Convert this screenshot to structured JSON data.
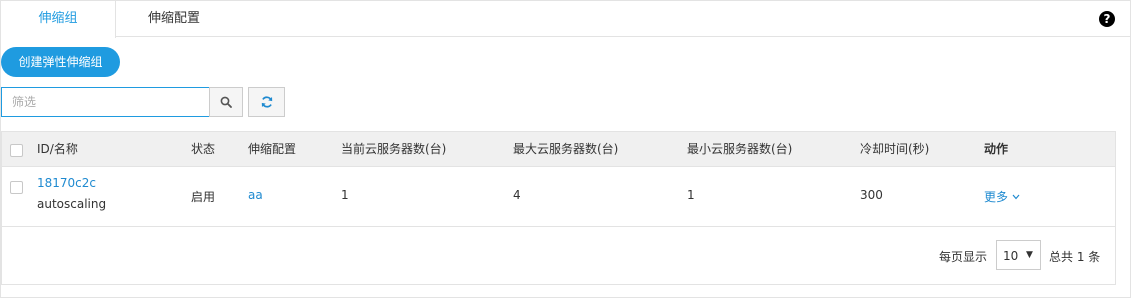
{
  "tabs": [
    {
      "label": "伸缩组",
      "active": true
    },
    {
      "label": "伸缩配置",
      "active": false
    }
  ],
  "help_icon": "question-circle-icon",
  "toolbar": {
    "create_label": "创建弹性伸缩组",
    "filter_placeholder": "筛选",
    "filter_value": "",
    "search_icon": "search-icon",
    "refresh_icon": "refresh-icon"
  },
  "table": {
    "columns": [
      "ID/名称",
      "状态",
      "伸缩配置",
      "当前云服务器数(台)",
      "最大云服务器数(台)",
      "最小云服务器数(台)",
      "冷却时间(秒)",
      "动作"
    ],
    "rows": [
      {
        "id": "18170c2c",
        "name": "autoscaling",
        "status": "启用",
        "config": "aa",
        "current": "1",
        "max": "4",
        "min": "1",
        "cooldown": "300",
        "action": "更多"
      }
    ]
  },
  "pagination": {
    "per_page_label": "每页显示",
    "per_page_value": "10",
    "total_label": "总共 1 条"
  },
  "colors": {
    "accent": "#1f9be0",
    "link": "#1f8ad0",
    "header_bg": "#f0f0f0",
    "border": "#e3e3e3"
  }
}
